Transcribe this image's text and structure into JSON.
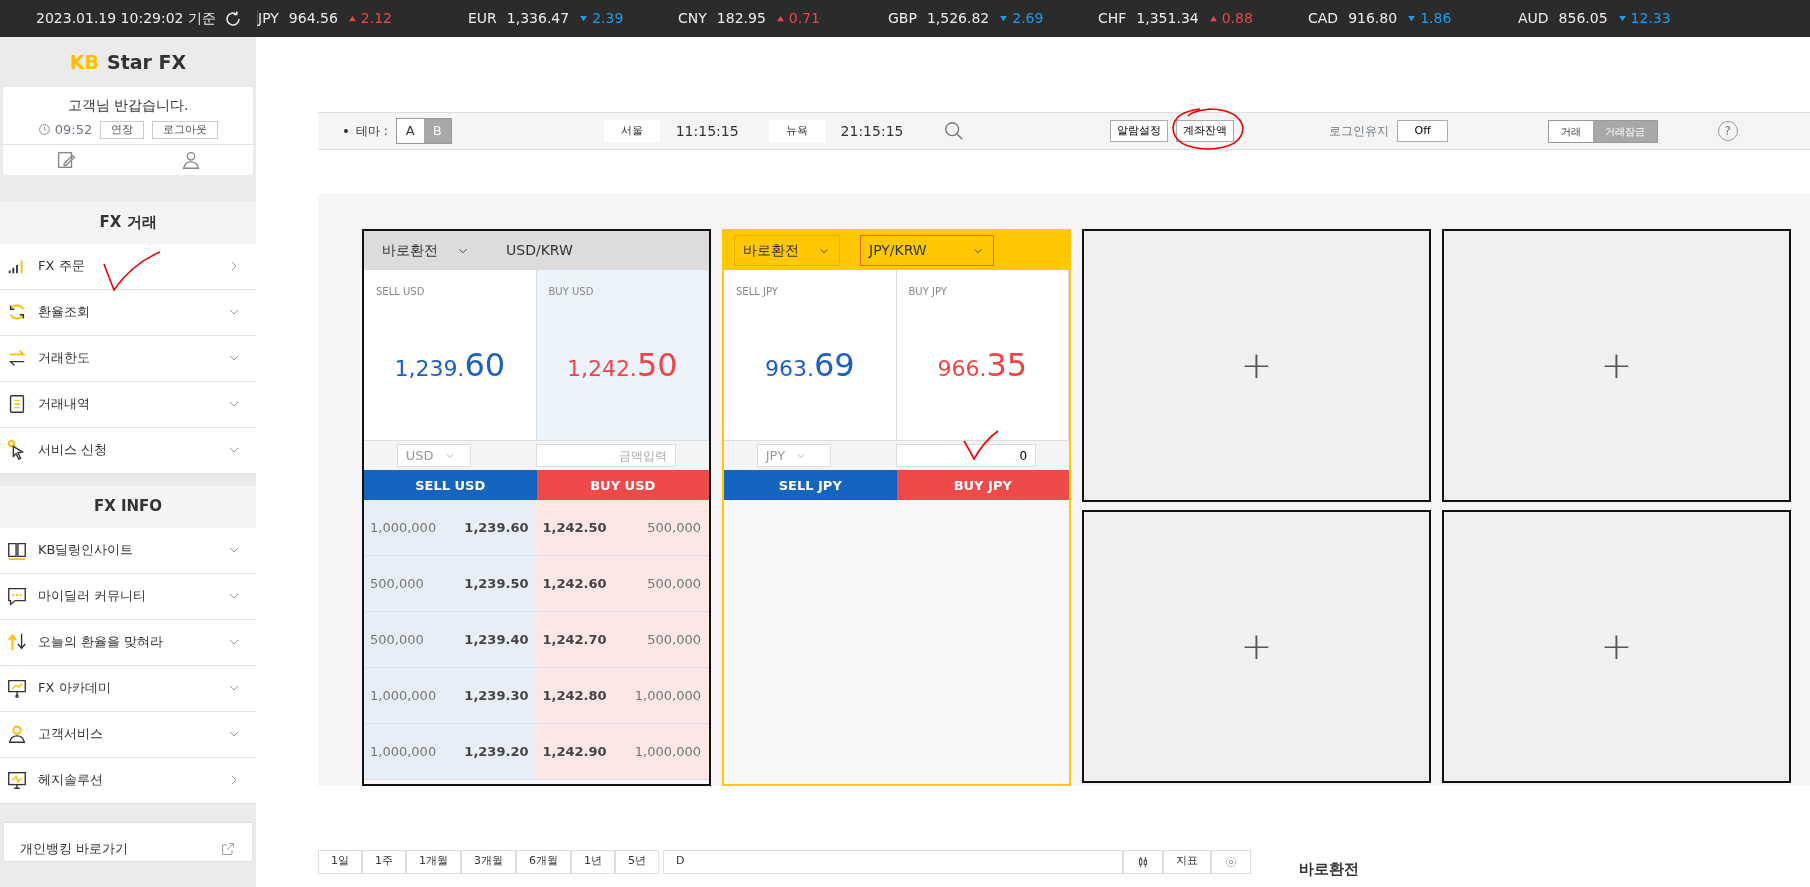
{
  "ticker": {
    "timestamp": "2023.01.19 10:29:02 기준",
    "rates": [
      {
        "currency": "JPY",
        "price": "964.56",
        "rising": true,
        "change": "2.12"
      },
      {
        "currency": "EUR",
        "price": "1,336.47",
        "rising": false,
        "change": "2.39"
      },
      {
        "currency": "CNY",
        "price": "182.95",
        "rising": true,
        "change": "0.71"
      },
      {
        "currency": "GBP",
        "price": "1,526.82",
        "rising": false,
        "change": "2.69"
      },
      {
        "currency": "CHF",
        "price": "1,351.34",
        "rising": true,
        "change": "0.88"
      },
      {
        "currency": "CAD",
        "price": "916.80",
        "rising": false,
        "change": "1.86"
      },
      {
        "currency": "AUD",
        "price": "856.05",
        "rising": false,
        "change": "12.33"
      }
    ]
  },
  "sidebar": {
    "logo": {
      "mark": "KB",
      "text": "Star FX"
    },
    "user": {
      "greeting": "고객님 반갑습니다.",
      "time": "09:52",
      "buttons": [
        "연장",
        "로그아웃"
      ]
    },
    "sections": [
      {
        "title": "FX 거래",
        "items": [
          {
            "label": "FX 주문",
            "kind": "link"
          },
          {
            "label": "환율조회",
            "kind": "menu"
          },
          {
            "label": "거래한도",
            "kind": "menu"
          },
          {
            "label": "거래내역",
            "kind": "menu"
          },
          {
            "label": "서비스 신청",
            "kind": "menu"
          }
        ]
      },
      {
        "title": "FX INFO",
        "items": [
          {
            "label": "KB딜링인사이트",
            "kind": "menu"
          },
          {
            "label": "마이딜러 커뮤니티",
            "kind": "menu"
          },
          {
            "label": "오늘의 환율을 맞혀라",
            "kind": "menu"
          },
          {
            "label": "FX 아카데미",
            "kind": "menu"
          },
          {
            "label": "고객서비스",
            "kind": "menu"
          },
          {
            "label": "헤지솔루션",
            "kind": "link"
          }
        ]
      }
    ],
    "bottom_link": "개인뱅킹 바로가기"
  },
  "toolbar": {
    "theme_label": "테마 :",
    "themes": [
      {
        "label": "A",
        "selected": false
      },
      {
        "label": "B",
        "selected": true
      }
    ],
    "clocks": [
      {
        "city": "서울",
        "time": "11:15:15"
      },
      {
        "city": "뉴욕",
        "time": "21:15:15"
      }
    ],
    "buttons": [
      "알람설정",
      "계좌잔액"
    ],
    "keep_login": {
      "label": "로그인유지",
      "value": "Off"
    },
    "modes": [
      {
        "label": "거래",
        "selected": false
      },
      {
        "label": "거래잠금",
        "selected": true
      }
    ],
    "help": "?"
  },
  "panels": [
    {
      "kind": "trade",
      "active": false,
      "type": "바로환전",
      "pair": "USD/KRW",
      "sell": {
        "label": "SELL USD",
        "int": "1,239.",
        "frac": "60"
      },
      "buy": {
        "label": "BUY USD",
        "int": "1,242.",
        "frac": "50"
      },
      "currency": "USD",
      "amount": {
        "placeholder": "금액입력"
      },
      "sell_button": "SELL USD",
      "buy_button": "BUY USD",
      "book": [
        {
          "sell_qty": "1,000,000",
          "sell_price": "1,239.60",
          "buy_price": "1,242.50",
          "buy_qty": "500,000"
        },
        {
          "sell_qty": "500,000",
          "sell_price": "1,239.50",
          "buy_price": "1,242.60",
          "buy_qty": "500,000"
        },
        {
          "sell_qty": "500,000",
          "sell_price": "1,239.40",
          "buy_price": "1,242.70",
          "buy_qty": "500,000"
        },
        {
          "sell_qty": "1,000,000",
          "sell_price": "1,239.30",
          "buy_price": "1,242.80",
          "buy_qty": "1,000,000"
        },
        {
          "sell_qty": "1,000,000",
          "sell_price": "1,239.20",
          "buy_price": "1,242.90",
          "buy_qty": "1,000,000"
        }
      ]
    },
    {
      "kind": "trade",
      "active": true,
      "type": "바로환전",
      "pair": "JPY/KRW",
      "sell": {
        "label": "SELL JPY",
        "int": "963.",
        "frac": "69"
      },
      "buy": {
        "label": "BUY JPY",
        "int": "966.",
        "frac": "35"
      },
      "currency": "JPY",
      "amount": {
        "value": "0"
      },
      "sell_button": "SELL JPY",
      "buy_button": "BUY JPY"
    },
    {
      "kind": "empty",
      "slots": [
        "+",
        "+"
      ]
    },
    {
      "kind": "empty",
      "slots": [
        "+",
        "+"
      ]
    }
  ],
  "chart_toolbar": {
    "periods": [
      "1일",
      "1주",
      "1개월",
      "3개월",
      "6개월",
      "1년",
      "5년"
    ],
    "interval": "D",
    "indicator": "지표"
  },
  "side_heading": "바로환전"
}
